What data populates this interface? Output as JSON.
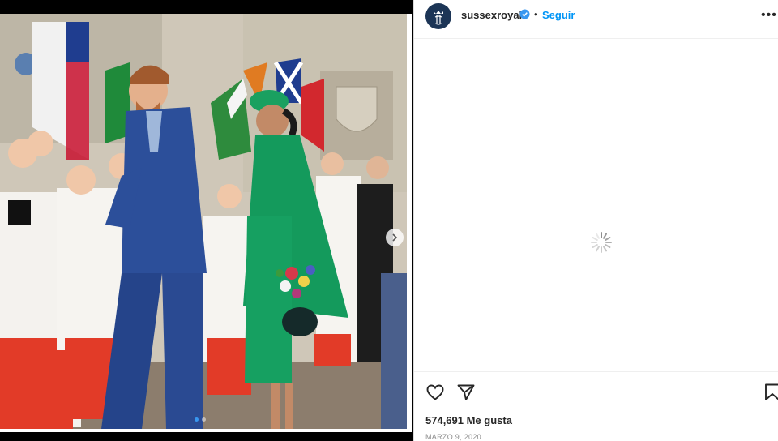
{
  "post": {
    "username": "sussexroyal",
    "follow_label": "Seguir",
    "separator": "•",
    "more_label": "•••",
    "likes_text": "574,691 Me gusta",
    "date_text": "MARZO 9, 2020"
  },
  "carousel": {
    "current_index": 1,
    "total": 2
  },
  "icons": {
    "avatar": "royal-monogram-icon",
    "verified": "verified-badge-icon",
    "like": "heart-icon",
    "share": "paper-plane-icon",
    "save": "bookmark-icon",
    "next": "chevron-right-icon",
    "loading": "spinner-icon"
  },
  "colors": {
    "follow": "#0095f6",
    "verified": "#3897f0",
    "avatar_bg": "#1c3556"
  }
}
